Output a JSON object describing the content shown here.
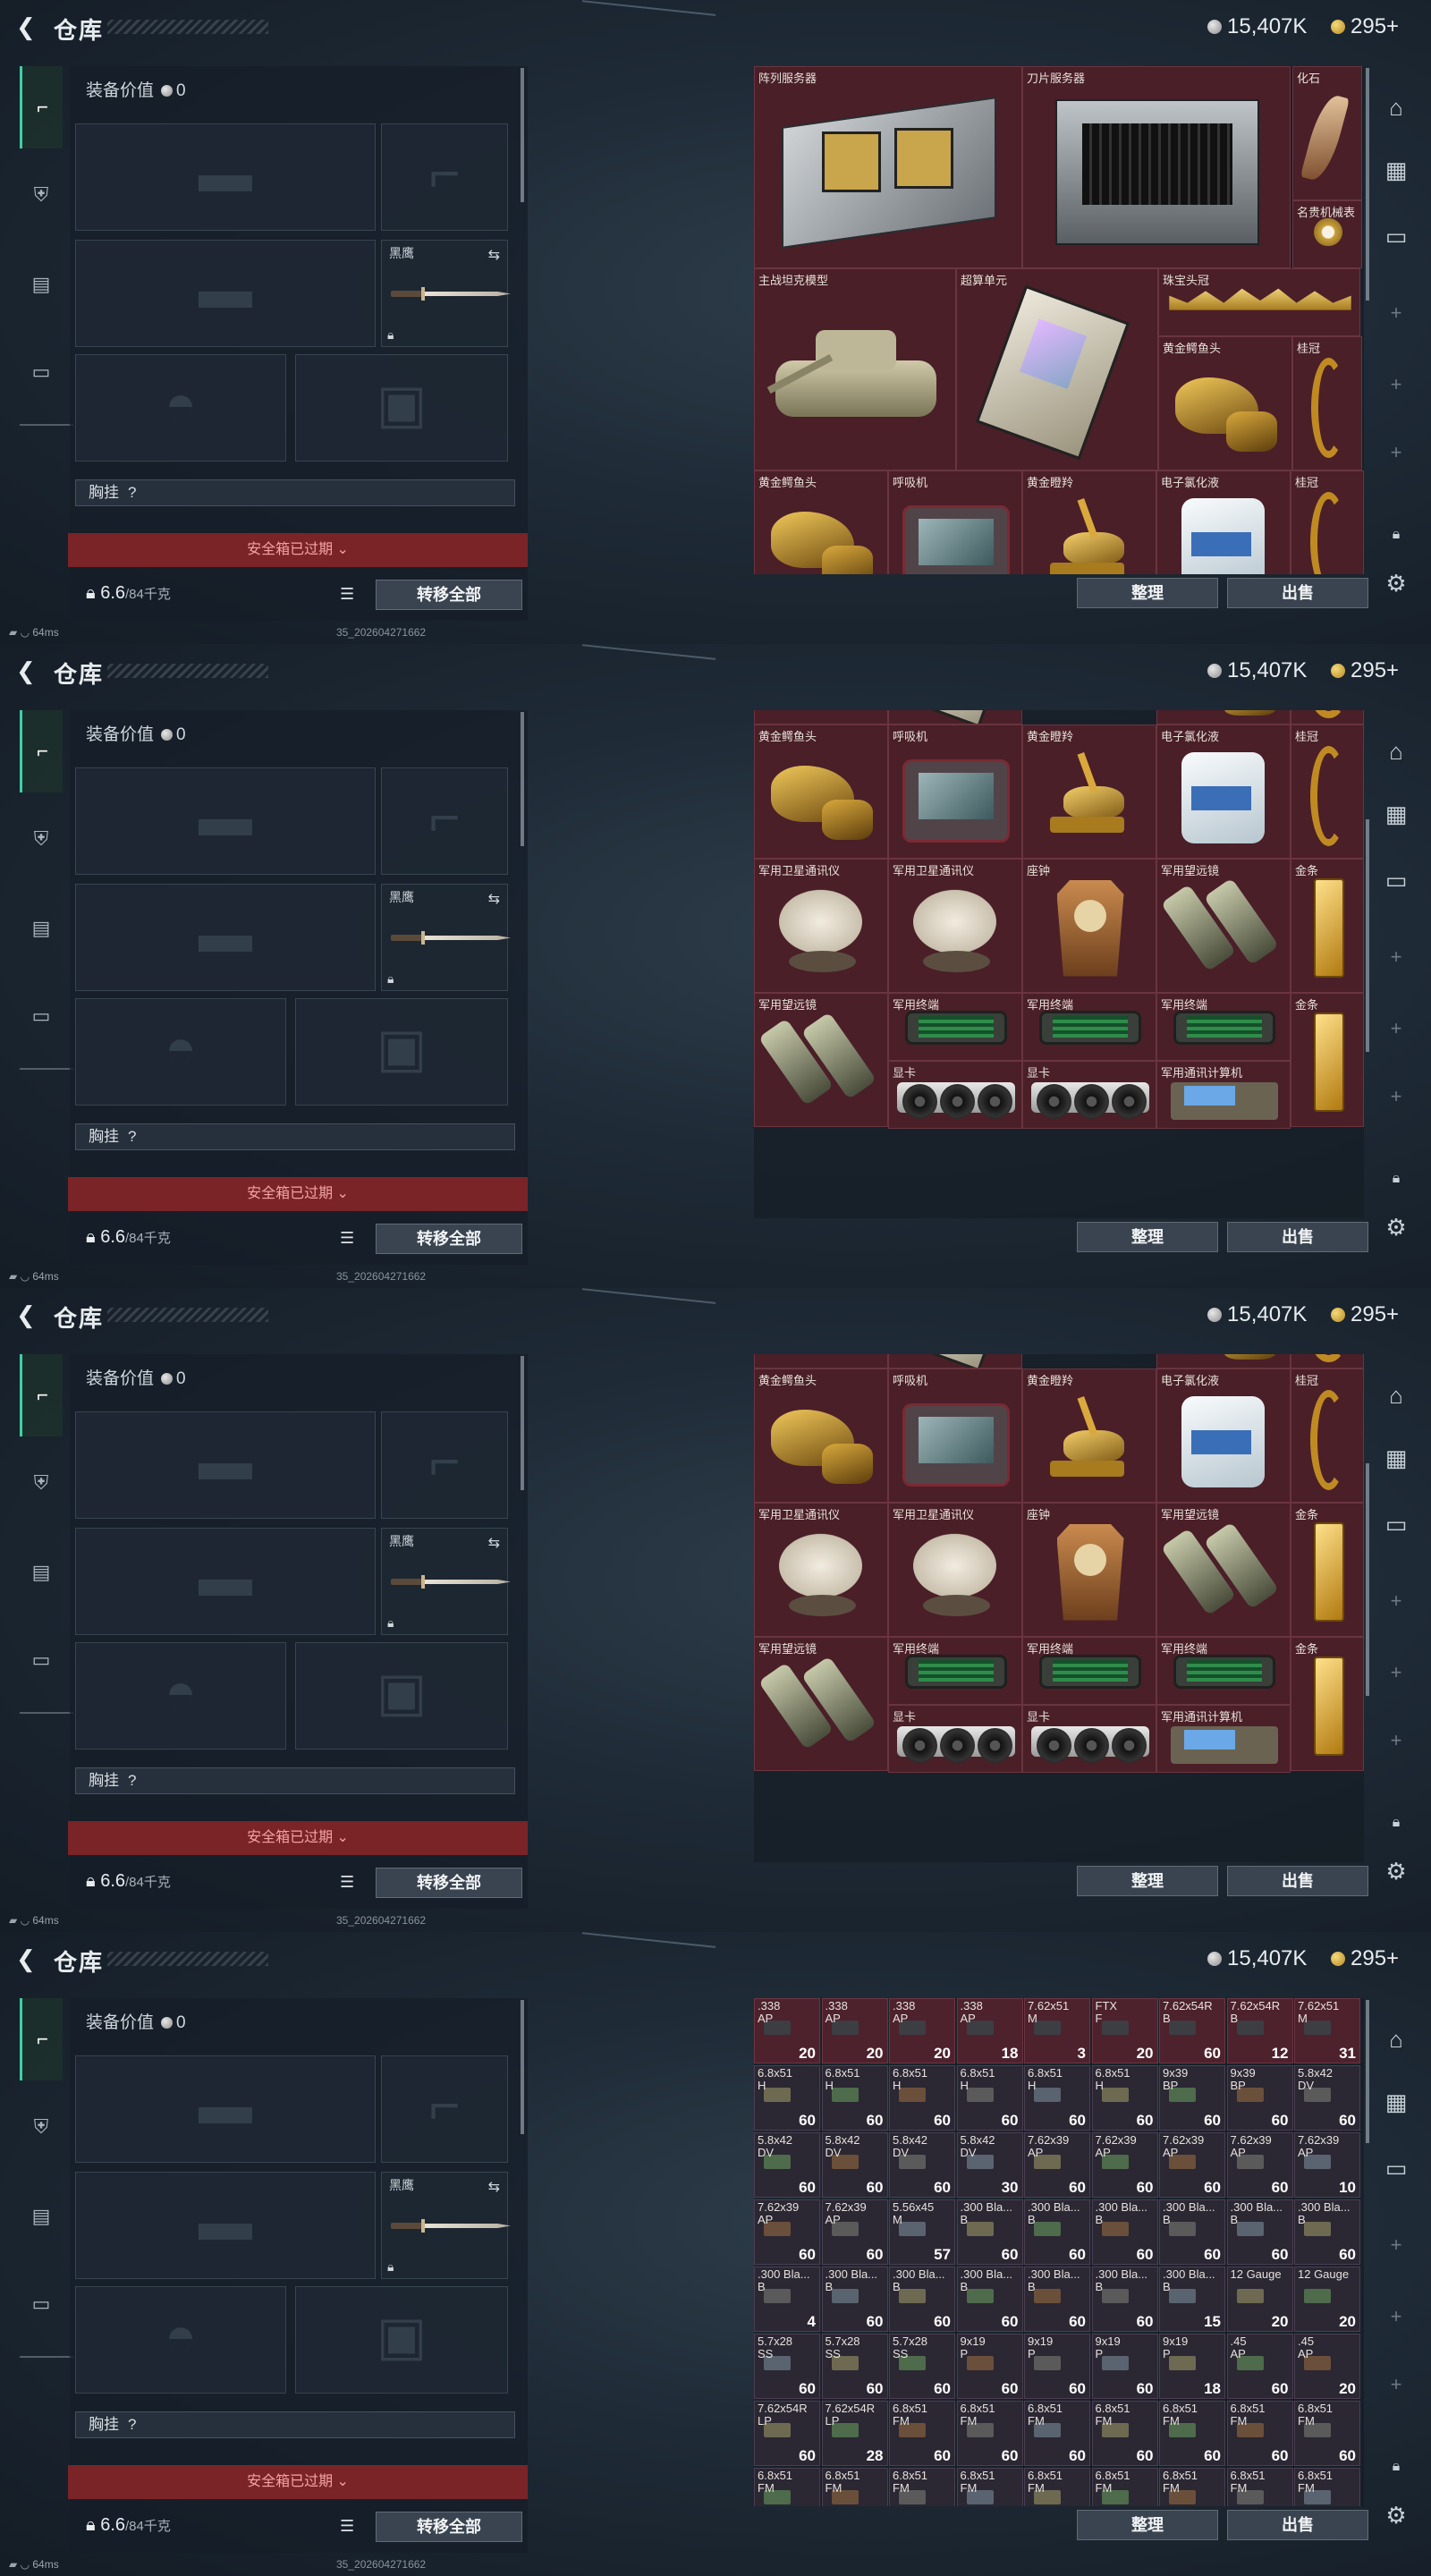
{
  "header": {
    "title": "仓库",
    "currency_silver": "15,407K",
    "currency_gold": "295+"
  },
  "equipment": {
    "value_label": "装备价值",
    "value": "0",
    "melee_label": "黑鹰",
    "rig_label": "胸挂",
    "rig_badge": "?",
    "expired_text": "安全箱已过期",
    "weight": "6.6",
    "weight_unit": "/84千克",
    "transfer_all": "转移全部"
  },
  "toolbar": {
    "sort": "整理",
    "sell": "出售"
  },
  "status": {
    "ping": "64ms",
    "build": "35_202604271662"
  },
  "panels": [
    {
      "items": [
        {
          "name": "阵列服务器",
          "art": "server"
        },
        {
          "name": "刀片服务器",
          "art": "blade"
        },
        {
          "name": "化石",
          "art": "fossil"
        },
        {
          "name": "名贵机械表",
          "art": "watch"
        },
        {
          "name": "主战坦克模型",
          "art": "tank"
        },
        {
          "name": "超算单元",
          "art": "gpuunit"
        },
        {
          "name": "珠宝头冠",
          "art": "crown"
        },
        {
          "name": "黄金鳄鱼头",
          "art": "croc"
        },
        {
          "name": "桂冠",
          "art": "laurel"
        },
        {
          "name": "黄金鳄鱼头",
          "art": "croc"
        },
        {
          "name": "呼吸机",
          "art": "vent"
        },
        {
          "name": "黄金瞪羚",
          "art": "gazelle"
        },
        {
          "name": "电子氯化液",
          "art": "jug"
        },
        {
          "name": "桂冠",
          "art": "laurel"
        }
      ]
    },
    {
      "items": [
        {
          "name": "黄金鳄鱼头",
          "art": "croc"
        },
        {
          "name": "呼吸机",
          "art": "vent"
        },
        {
          "name": "黄金瞪羚",
          "art": "gazelle"
        },
        {
          "name": "电子氯化液",
          "art": "jug"
        },
        {
          "name": "桂冠",
          "art": "laurel"
        },
        {
          "name": "军用卫星通讯仪",
          "art": "dish"
        },
        {
          "name": "军用卫星通讯仪",
          "art": "dish"
        },
        {
          "name": "座钟",
          "art": "clock"
        },
        {
          "name": "军用望远镜",
          "art": "bino"
        },
        {
          "name": "金条",
          "art": "gold"
        },
        {
          "name": "军用望远镜",
          "art": "bino"
        },
        {
          "name": "军用终端",
          "art": "term"
        },
        {
          "name": "军用终端",
          "art": "term"
        },
        {
          "name": "军用终端",
          "art": "term"
        },
        {
          "name": "金条",
          "art": "gold"
        },
        {
          "name": "显卡",
          "art": "gpu"
        },
        {
          "name": "显卡",
          "art": "gpu"
        },
        {
          "name": "军用通讯计算机",
          "art": "comp"
        }
      ]
    },
    {
      "items": [
        {
          "name": "黄金鳄鱼头",
          "art": "croc"
        },
        {
          "name": "呼吸机",
          "art": "vent"
        },
        {
          "name": "黄金瞪羚",
          "art": "gazelle"
        },
        {
          "name": "电子氯化液",
          "art": "jug"
        },
        {
          "name": "桂冠",
          "art": "laurel"
        },
        {
          "name": "军用卫星通讯仪",
          "art": "dish"
        },
        {
          "name": "军用卫星通讯仪",
          "art": "dish"
        },
        {
          "name": "座钟",
          "art": "clock"
        },
        {
          "name": "军用望远镜",
          "art": "bino"
        },
        {
          "name": "金条",
          "art": "gold"
        },
        {
          "name": "军用望远镜",
          "art": "bino"
        },
        {
          "name": "军用终端",
          "art": "term"
        },
        {
          "name": "军用终端",
          "art": "term"
        },
        {
          "name": "军用终端",
          "art": "term"
        },
        {
          "name": "金条",
          "art": "gold"
        },
        {
          "name": "显卡",
          "art": "gpu"
        },
        {
          "name": "显卡",
          "art": "gpu"
        },
        {
          "name": "军用通讯计算机",
          "art": "comp"
        }
      ]
    }
  ],
  "ammo": [
    [
      ".338\nAP",
      "20",
      "red"
    ],
    [
      ".338\nAP",
      "20",
      "red"
    ],
    [
      ".338\nAP",
      "20",
      "red"
    ],
    [
      ".338\nAP",
      "18",
      "red"
    ],
    [
      "7.62x51\nM",
      "3",
      "red"
    ],
    [
      "FTX\nF",
      "20",
      "red"
    ],
    [
      "7.62x54R\nB",
      "60",
      "red"
    ],
    [
      "7.62x54R\nB",
      "12",
      "red"
    ],
    [
      "7.62x51\nM",
      "31",
      "red"
    ],
    [
      "6.8x51\nH",
      "60",
      ""
    ],
    [
      "6.8x51\nH",
      "60",
      ""
    ],
    [
      "6.8x51\nH",
      "60",
      ""
    ],
    [
      "6.8x51\nH",
      "60",
      ""
    ],
    [
      "6.8x51\nH",
      "60",
      ""
    ],
    [
      "6.8x51\nH",
      "60",
      ""
    ],
    [
      "9x39\nBP",
      "60",
      ""
    ],
    [
      "9x39\nBP",
      "60",
      ""
    ],
    [
      "5.8x42\nDV",
      "60",
      ""
    ],
    [
      "5.8x42\nDV",
      "60",
      ""
    ],
    [
      "5.8x42\nDV",
      "60",
      ""
    ],
    [
      "5.8x42\nDV",
      "60",
      ""
    ],
    [
      "5.8x42\nDV",
      "30",
      ""
    ],
    [
      "7.62x39\nAP",
      "60",
      ""
    ],
    [
      "7.62x39\nAP",
      "60",
      ""
    ],
    [
      "7.62x39\nAP",
      "60",
      ""
    ],
    [
      "7.62x39\nAP",
      "60",
      ""
    ],
    [
      "7.62x39\nAP",
      "10",
      ""
    ],
    [
      "7.62x39\nAP",
      "60",
      ""
    ],
    [
      "7.62x39\nAP",
      "60",
      ""
    ],
    [
      "5.56x45\nM",
      "57",
      ""
    ],
    [
      ".300 Bla...\nB",
      "60",
      ""
    ],
    [
      ".300 Bla...\nB",
      "60",
      ""
    ],
    [
      ".300 Bla...\nB",
      "60",
      ""
    ],
    [
      ".300 Bla...\nB",
      "60",
      ""
    ],
    [
      ".300 Bla...\nB",
      "60",
      ""
    ],
    [
      ".300 Bla...\nB",
      "60",
      ""
    ],
    [
      ".300 Bla...\nB",
      "4",
      ""
    ],
    [
      ".300 Bla...\nB",
      "60",
      ""
    ],
    [
      ".300 Bla...\nB",
      "60",
      ""
    ],
    [
      ".300 Bla...\nB",
      "60",
      ""
    ],
    [
      ".300 Bla...\nB",
      "60",
      ""
    ],
    [
      ".300 Bla...\nB",
      "60",
      ""
    ],
    [
      ".300 Bla...\nB",
      "15",
      ""
    ],
    [
      "12 Gauge\n",
      "20",
      ""
    ],
    [
      "12 Gauge\n",
      "20",
      ""
    ],
    [
      "5.7x28\nSS",
      "60",
      ""
    ],
    [
      "5.7x28\nSS",
      "60",
      ""
    ],
    [
      "5.7x28\nSS",
      "60",
      ""
    ],
    [
      "9x19\nP",
      "60",
      ""
    ],
    [
      "9x19\nP",
      "60",
      ""
    ],
    [
      "9x19\nP",
      "60",
      ""
    ],
    [
      "9x19\nP",
      "18",
      ""
    ],
    [
      ".45\nAP",
      "60",
      ""
    ],
    [
      ".45\nAP",
      "20",
      ""
    ],
    [
      "7.62x54R\nLP",
      "60",
      ""
    ],
    [
      "7.62x54R\nLP",
      "28",
      ""
    ],
    [
      "6.8x51\nFM",
      "60",
      ""
    ],
    [
      "6.8x51\nFM",
      "60",
      ""
    ],
    [
      "6.8x51\nFM",
      "60",
      ""
    ],
    [
      "6.8x51\nFM",
      "60",
      ""
    ],
    [
      "6.8x51\nFM",
      "60",
      ""
    ],
    [
      "6.8x51\nFM",
      "60",
      ""
    ],
    [
      "6.8x51\nFM",
      "60",
      ""
    ],
    [
      "6.8x51\nFM",
      "",
      ""
    ],
    [
      "6.8x51\nFM",
      "",
      ""
    ],
    [
      "6.8x51\nFM",
      "",
      ""
    ],
    [
      "6.8x51\nFM",
      "",
      ""
    ],
    [
      "6.8x51\nFM",
      "",
      ""
    ],
    [
      "6.8x51\nFM",
      "",
      ""
    ],
    [
      "6.8x51\nFM",
      "",
      ""
    ],
    [
      "6.8x51\nFM",
      "",
      ""
    ],
    [
      "6.8x51\nFM",
      "",
      ""
    ]
  ]
}
